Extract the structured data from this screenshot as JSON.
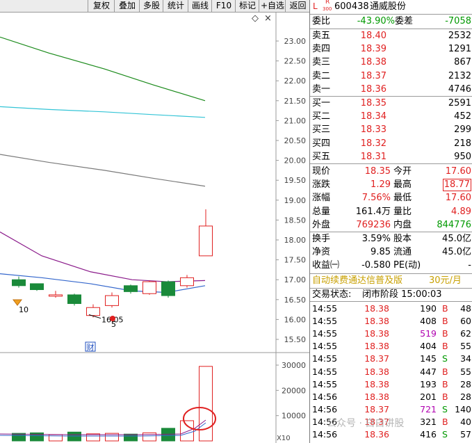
{
  "toolbar": {
    "buttons": [
      "复权",
      "叠加",
      "多股",
      "统计",
      "画线",
      "F10",
      "标记",
      "+自选",
      "返回"
    ]
  },
  "chart": {
    "price_axis_labels": [
      "23.00",
      "22.50",
      "22.00",
      "21.50",
      "21.00",
      "20.50",
      "20.00",
      "19.50",
      "19.00",
      "18.50",
      "18.00",
      "17.50",
      "17.00",
      "16.50",
      "16.00",
      "15.50"
    ],
    "volume_axis_labels": [
      "30000",
      "20000",
      "10000"
    ],
    "volume_unit": "X10",
    "low_annotation": "16.05",
    "marker_10": "10",
    "marker_5": "5",
    "finance_marker": "财",
    "diamond_icon": "◇",
    "close_icon": "×"
  },
  "chart_data": {
    "type": "candlestick",
    "y_range": [
      15.3,
      23.3
    ],
    "candles": [
      {
        "open": 17.0,
        "close": 16.85,
        "high": 17.08,
        "low": 16.8
      },
      {
        "open": 16.9,
        "close": 16.75,
        "high": 16.9,
        "low": 16.72
      },
      {
        "open": 16.6,
        "close": 16.62,
        "high": 16.72,
        "low": 16.55
      },
      {
        "open": 16.62,
        "close": 16.4,
        "high": 16.65,
        "low": 16.35
      },
      {
        "open": 16.1,
        "close": 16.3,
        "high": 16.38,
        "low": 16.05
      },
      {
        "open": 16.35,
        "close": 16.6,
        "high": 16.68,
        "low": 16.3
      },
      {
        "open": 16.85,
        "close": 16.7,
        "high": 16.88,
        "low": 16.65
      },
      {
        "open": 16.65,
        "close": 16.95,
        "high": 16.98,
        "low": 16.62
      },
      {
        "open": 16.95,
        "close": 16.6,
        "high": 16.98,
        "low": 16.55
      },
      {
        "open": 16.85,
        "close": 17.05,
        "high": 17.12,
        "low": 16.8
      },
      {
        "open": 17.6,
        "close": 18.35,
        "high": 18.77,
        "low": 17.6
      }
    ],
    "volumes": [
      3000,
      3200,
      2500,
      3500,
      2800,
      3000,
      2700,
      3200,
      5000,
      8000,
      29500
    ],
    "volume_range": [
      0,
      33000
    ],
    "ma_lines": {
      "green": [
        23.1,
        22.7,
        22.3,
        21.9,
        21.5
      ],
      "cyan": [
        21.35,
        21.28,
        21.22,
        21.15,
        21.08
      ],
      "gray": [
        20.15,
        19.95,
        19.75,
        19.55,
        19.35
      ],
      "purple": [
        18.2,
        17.6,
        17.2,
        17.0,
        16.95,
        16.98
      ],
      "blue": [
        17.15,
        17.05,
        16.9,
        16.72,
        16.68,
        16.85
      ]
    }
  },
  "quote": {
    "badge": "L",
    "market_tag": "R",
    "market_sub": "300",
    "code": "600438",
    "name": "通威股份",
    "weibi_label": "委比",
    "weibi": "-43.90%",
    "weicha_label": "委差",
    "weicha": "-7058",
    "asks": [
      {
        "label": "卖五",
        "price": "18.40",
        "volume": "2532"
      },
      {
        "label": "卖四",
        "price": "18.39",
        "volume": "1291"
      },
      {
        "label": "卖三",
        "price": "18.38",
        "volume": "867"
      },
      {
        "label": "卖二",
        "price": "18.37",
        "volume": "2132"
      },
      {
        "label": "卖一",
        "price": "18.36",
        "volume": "4746"
      }
    ],
    "bids": [
      {
        "label": "买一",
        "price": "18.35",
        "volume": "2591"
      },
      {
        "label": "买二",
        "price": "18.34",
        "volume": "452"
      },
      {
        "label": "买三",
        "price": "18.33",
        "volume": "299"
      },
      {
        "label": "买四",
        "price": "18.32",
        "volume": "218"
      },
      {
        "label": "买五",
        "price": "18.31",
        "volume": "950"
      }
    ],
    "stats": {
      "xianjia_label": "现价",
      "xianjia": "18.35",
      "jinkai_label": "今开",
      "jinkai": "17.60",
      "zhangdie_label": "涨跌",
      "zhangdie": "1.29",
      "zuigao_label": "最高",
      "zuigao": "18.77",
      "zhangfu_label": "涨幅",
      "zhangfu": "7.56%",
      "zuidi_label": "最低",
      "zuidi": "17.60",
      "zongliang_label": "总量",
      "zongliang": "161.4万",
      "liangbi_label": "量比",
      "liangbi": "4.89",
      "waipan_label": "外盘",
      "waipan": "769236",
      "neipan_label": "内盘",
      "neipan": "844776",
      "huanshou_label": "换手",
      "huanshou": "3.59%",
      "guben_label": "股本",
      "guben": "45.0亿",
      "jingzi_label": "净资",
      "jingzi": "9.85",
      "liutong_label": "流通",
      "liutong": "45.0亿",
      "shouyi_label": "收益㈠",
      "shouyi": "-0.580",
      "pe_label": "PE(动)",
      "pe": "-"
    },
    "ad_text": "自动续费通达信普及版",
    "ad_price": "30元/月",
    "status_label": "交易状态:",
    "status_value": "闭市阶段 15:00:03"
  },
  "trades": [
    {
      "time": "14:55",
      "price": "18.38",
      "volume": "190",
      "side": "B",
      "count": "48"
    },
    {
      "time": "14:55",
      "price": "18.38",
      "volume": "408",
      "side": "B",
      "count": "60"
    },
    {
      "time": "14:55",
      "price": "18.38",
      "volume": "519",
      "side": "B",
      "count": "62"
    },
    {
      "time": "14:55",
      "price": "18.38",
      "volume": "404",
      "side": "B",
      "count": "55"
    },
    {
      "time": "14:55",
      "price": "18.37",
      "volume": "145",
      "side": "S",
      "count": "34"
    },
    {
      "time": "14:55",
      "price": "18.38",
      "volume": "447",
      "side": "B",
      "count": "55"
    },
    {
      "time": "14:55",
      "price": "18.38",
      "volume": "193",
      "side": "B",
      "count": "28"
    },
    {
      "time": "14:56",
      "price": "18.38",
      "volume": "201",
      "side": "B",
      "count": "28"
    },
    {
      "time": "14:56",
      "price": "18.37",
      "volume": "721",
      "side": "S",
      "count": "140"
    },
    {
      "time": "14:56",
      "price": "18.37",
      "volume": "321",
      "side": "B",
      "count": "40"
    },
    {
      "time": "14:56",
      "price": "18.36",
      "volume": "416",
      "side": "S",
      "count": "57"
    }
  ],
  "watermark": "公众号 · 白白讲股"
}
